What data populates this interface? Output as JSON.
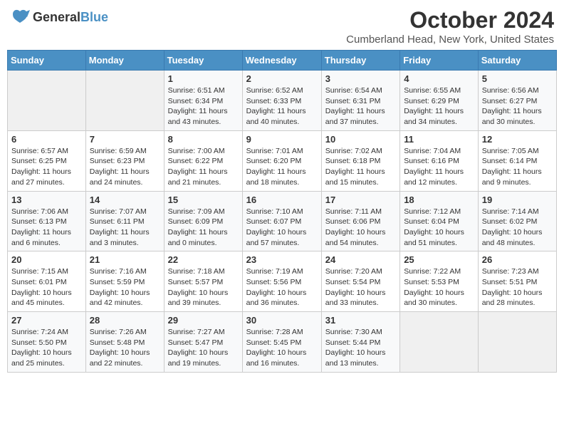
{
  "header": {
    "logo": {
      "general": "General",
      "blue": "Blue"
    },
    "title": "October 2024",
    "location": "Cumberland Head, New York, United States"
  },
  "weekdays": [
    "Sunday",
    "Monday",
    "Tuesday",
    "Wednesday",
    "Thursday",
    "Friday",
    "Saturday"
  ],
  "weeks": [
    [
      {
        "day": "",
        "info": ""
      },
      {
        "day": "",
        "info": ""
      },
      {
        "day": "1",
        "info": "Sunrise: 6:51 AM\nSunset: 6:34 PM\nDaylight: 11 hours and 43 minutes."
      },
      {
        "day": "2",
        "info": "Sunrise: 6:52 AM\nSunset: 6:33 PM\nDaylight: 11 hours and 40 minutes."
      },
      {
        "day": "3",
        "info": "Sunrise: 6:54 AM\nSunset: 6:31 PM\nDaylight: 11 hours and 37 minutes."
      },
      {
        "day": "4",
        "info": "Sunrise: 6:55 AM\nSunset: 6:29 PM\nDaylight: 11 hours and 34 minutes."
      },
      {
        "day": "5",
        "info": "Sunrise: 6:56 AM\nSunset: 6:27 PM\nDaylight: 11 hours and 30 minutes."
      }
    ],
    [
      {
        "day": "6",
        "info": "Sunrise: 6:57 AM\nSunset: 6:25 PM\nDaylight: 11 hours and 27 minutes."
      },
      {
        "day": "7",
        "info": "Sunrise: 6:59 AM\nSunset: 6:23 PM\nDaylight: 11 hours and 24 minutes."
      },
      {
        "day": "8",
        "info": "Sunrise: 7:00 AM\nSunset: 6:22 PM\nDaylight: 11 hours and 21 minutes."
      },
      {
        "day": "9",
        "info": "Sunrise: 7:01 AM\nSunset: 6:20 PM\nDaylight: 11 hours and 18 minutes."
      },
      {
        "day": "10",
        "info": "Sunrise: 7:02 AM\nSunset: 6:18 PM\nDaylight: 11 hours and 15 minutes."
      },
      {
        "day": "11",
        "info": "Sunrise: 7:04 AM\nSunset: 6:16 PM\nDaylight: 11 hours and 12 minutes."
      },
      {
        "day": "12",
        "info": "Sunrise: 7:05 AM\nSunset: 6:14 PM\nDaylight: 11 hours and 9 minutes."
      }
    ],
    [
      {
        "day": "13",
        "info": "Sunrise: 7:06 AM\nSunset: 6:13 PM\nDaylight: 11 hours and 6 minutes."
      },
      {
        "day": "14",
        "info": "Sunrise: 7:07 AM\nSunset: 6:11 PM\nDaylight: 11 hours and 3 minutes."
      },
      {
        "day": "15",
        "info": "Sunrise: 7:09 AM\nSunset: 6:09 PM\nDaylight: 11 hours and 0 minutes."
      },
      {
        "day": "16",
        "info": "Sunrise: 7:10 AM\nSunset: 6:07 PM\nDaylight: 10 hours and 57 minutes."
      },
      {
        "day": "17",
        "info": "Sunrise: 7:11 AM\nSunset: 6:06 PM\nDaylight: 10 hours and 54 minutes."
      },
      {
        "day": "18",
        "info": "Sunrise: 7:12 AM\nSunset: 6:04 PM\nDaylight: 10 hours and 51 minutes."
      },
      {
        "day": "19",
        "info": "Sunrise: 7:14 AM\nSunset: 6:02 PM\nDaylight: 10 hours and 48 minutes."
      }
    ],
    [
      {
        "day": "20",
        "info": "Sunrise: 7:15 AM\nSunset: 6:01 PM\nDaylight: 10 hours and 45 minutes."
      },
      {
        "day": "21",
        "info": "Sunrise: 7:16 AM\nSunset: 5:59 PM\nDaylight: 10 hours and 42 minutes."
      },
      {
        "day": "22",
        "info": "Sunrise: 7:18 AM\nSunset: 5:57 PM\nDaylight: 10 hours and 39 minutes."
      },
      {
        "day": "23",
        "info": "Sunrise: 7:19 AM\nSunset: 5:56 PM\nDaylight: 10 hours and 36 minutes."
      },
      {
        "day": "24",
        "info": "Sunrise: 7:20 AM\nSunset: 5:54 PM\nDaylight: 10 hours and 33 minutes."
      },
      {
        "day": "25",
        "info": "Sunrise: 7:22 AM\nSunset: 5:53 PM\nDaylight: 10 hours and 30 minutes."
      },
      {
        "day": "26",
        "info": "Sunrise: 7:23 AM\nSunset: 5:51 PM\nDaylight: 10 hours and 28 minutes."
      }
    ],
    [
      {
        "day": "27",
        "info": "Sunrise: 7:24 AM\nSunset: 5:50 PM\nDaylight: 10 hours and 25 minutes."
      },
      {
        "day": "28",
        "info": "Sunrise: 7:26 AM\nSunset: 5:48 PM\nDaylight: 10 hours and 22 minutes."
      },
      {
        "day": "29",
        "info": "Sunrise: 7:27 AM\nSunset: 5:47 PM\nDaylight: 10 hours and 19 minutes."
      },
      {
        "day": "30",
        "info": "Sunrise: 7:28 AM\nSunset: 5:45 PM\nDaylight: 10 hours and 16 minutes."
      },
      {
        "day": "31",
        "info": "Sunrise: 7:30 AM\nSunset: 5:44 PM\nDaylight: 10 hours and 13 minutes."
      },
      {
        "day": "",
        "info": ""
      },
      {
        "day": "",
        "info": ""
      }
    ]
  ]
}
